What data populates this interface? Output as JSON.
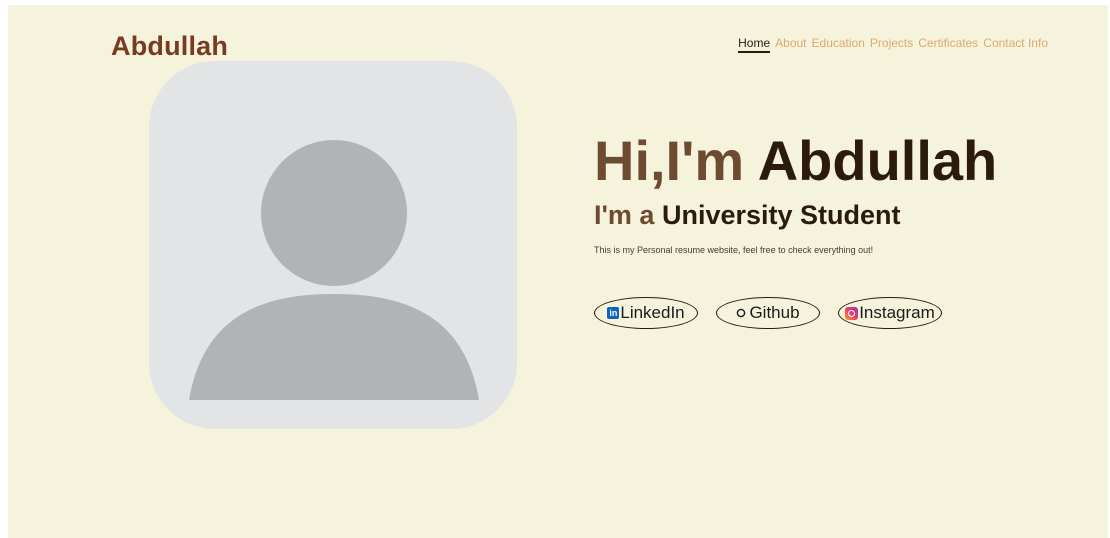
{
  "header": {
    "logo": "Abdullah",
    "nav": [
      {
        "label": "Home",
        "active": true
      },
      {
        "label": "About",
        "active": false
      },
      {
        "label": "Education",
        "active": false
      },
      {
        "label": "Projects",
        "active": false
      },
      {
        "label": "Certificates",
        "active": false
      },
      {
        "label": "Contact Info",
        "active": false
      }
    ]
  },
  "hero": {
    "greeting_lead": "Hi,I'm",
    "greeting_name": "Abdullah",
    "role_lead": "I'm a",
    "role_job": "University Student",
    "tagline": "This is my Personal resume website, feel free to check everything out!"
  },
  "socials": [
    {
      "label": "LinkedIn",
      "icon": "linkedin-icon"
    },
    {
      "label": "Github",
      "icon": "github-icon"
    },
    {
      "label": "Instagram",
      "icon": "instagram-icon"
    }
  ],
  "colors": {
    "background": "#f5f3dc",
    "logo": "#7a3a1f",
    "nav_link": "#e0a870",
    "heading_dark": "#2c1a0c",
    "heading_brown": "#6e4a30",
    "avatar_bg": "#e3e4e5",
    "avatar_figure": "#b0b4b7"
  }
}
